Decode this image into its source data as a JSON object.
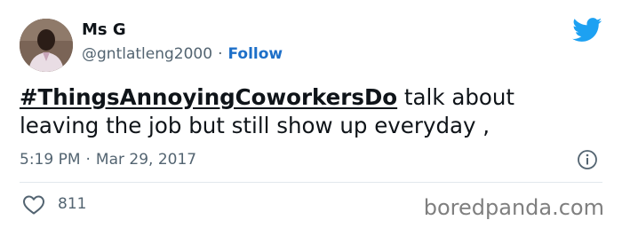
{
  "user": {
    "display_name": "Ms G",
    "handle": "@gntlatleng2000",
    "separator": "·",
    "follow_label": "Follow"
  },
  "tweet": {
    "hashtag": "#ThingsAnnoyingCoworkersDo",
    "text": " talk about leaving the job but still show up everyday ,"
  },
  "meta": {
    "time": "5:19 PM",
    "separator": "·",
    "date": "Mar 29, 2017"
  },
  "actions": {
    "like_count": "811"
  },
  "watermark": "boredpanda.com",
  "colors": {
    "twitter_blue": "#1da1f2",
    "link_blue": "#1d6fc8",
    "secondary_text": "#536471",
    "primary_text": "#0f1419",
    "divider": "#e1e8ed"
  },
  "icons": [
    "twitter-bird-icon",
    "info-icon",
    "heart-icon"
  ]
}
